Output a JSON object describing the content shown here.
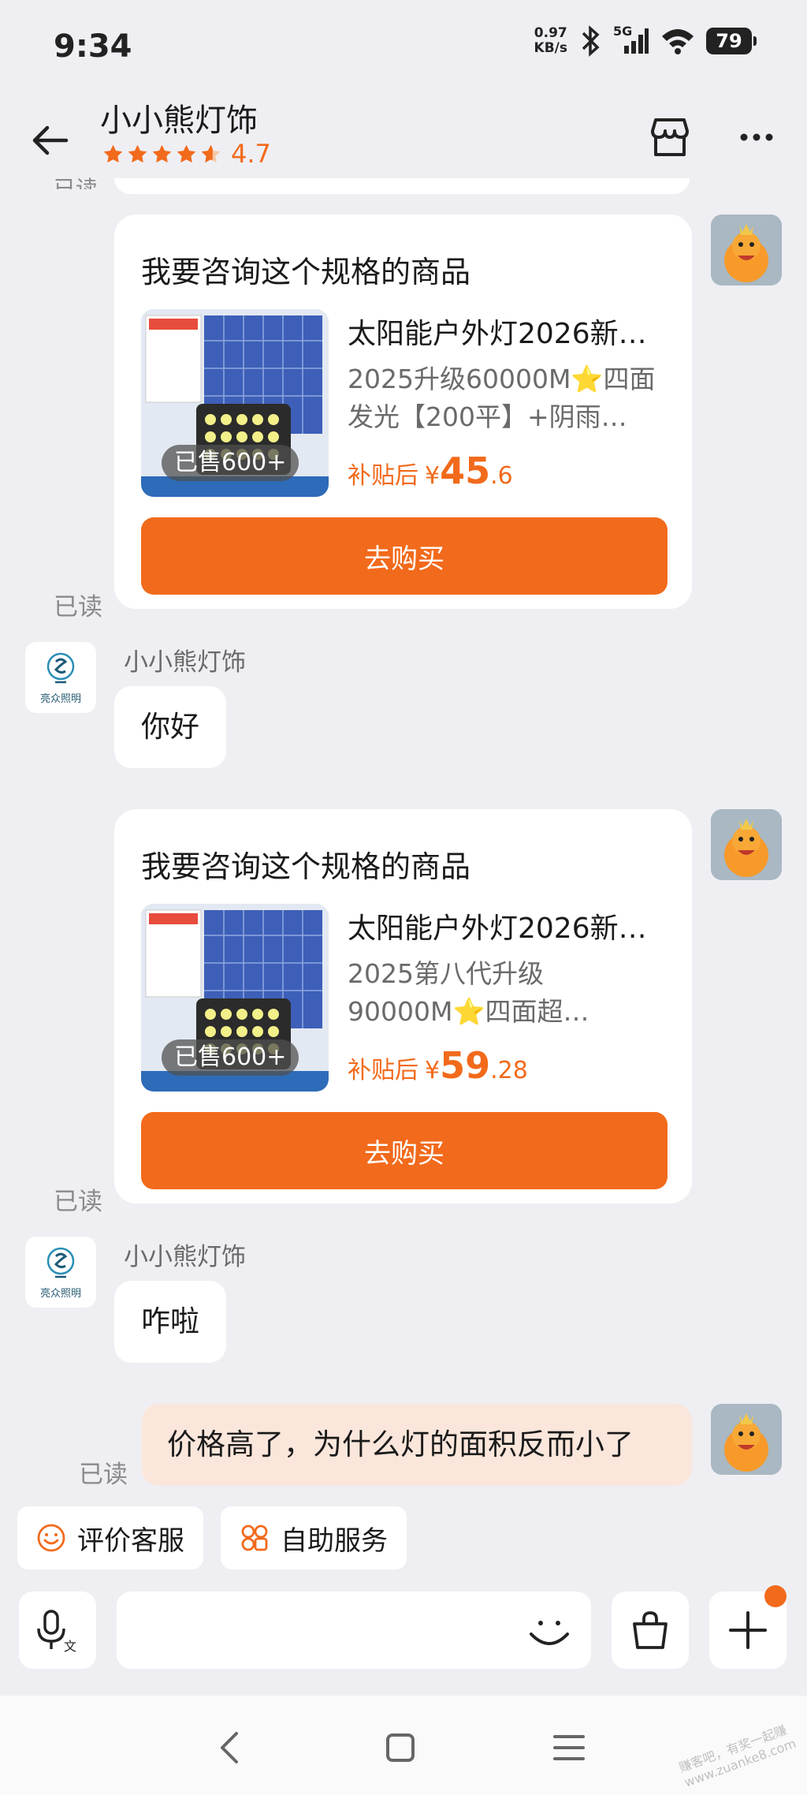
{
  "status_bar": {
    "time": "9:34",
    "net_speed": "0.97",
    "net_unit": "KB/s",
    "network": "5G",
    "battery": "79"
  },
  "header": {
    "title": "小小熊灯饰",
    "rating": "4.7",
    "rating_stars": 4.7
  },
  "read_label": "已读",
  "messages": {
    "card1": {
      "title": "我要咨询这个规格的商品",
      "product_name": "太阳能户外灯2026新…",
      "desc": "2025升级60000M⭐四面发光【200平】+阴雨…",
      "sold": "已售600+",
      "price_label": "补贴后",
      "price_yen": "¥",
      "price_int": "45",
      "price_dec": ".6",
      "button": "去购买"
    },
    "reply1": {
      "sender": "小小熊灯饰",
      "text": "你好"
    },
    "card2": {
      "title": "我要咨询这个规格的商品",
      "product_name": "太阳能户外灯2026新…",
      "desc": "2025第八代升级90000M⭐四面超…",
      "sold": "已售600+",
      "price_label": "补贴后",
      "price_yen": "¥",
      "price_int": "59",
      "price_dec": ".28",
      "button": "去购买"
    },
    "reply2": {
      "sender": "小小熊灯饰",
      "text": "咋啦"
    },
    "my_message": {
      "text": "价格高了，为什么灯的面积反而小了"
    }
  },
  "shop_avatar_text": "亮众照明",
  "quick_actions": {
    "rate": "评价客服",
    "self_service": "自助服务"
  },
  "input": {
    "placeholder": ""
  },
  "watermark": "赚客吧，有奖一起赚 www.zuanke8.com",
  "colors": {
    "accent": "#f26a1b",
    "my_bubble": "#fbe6db",
    "background": "#efeff3"
  }
}
